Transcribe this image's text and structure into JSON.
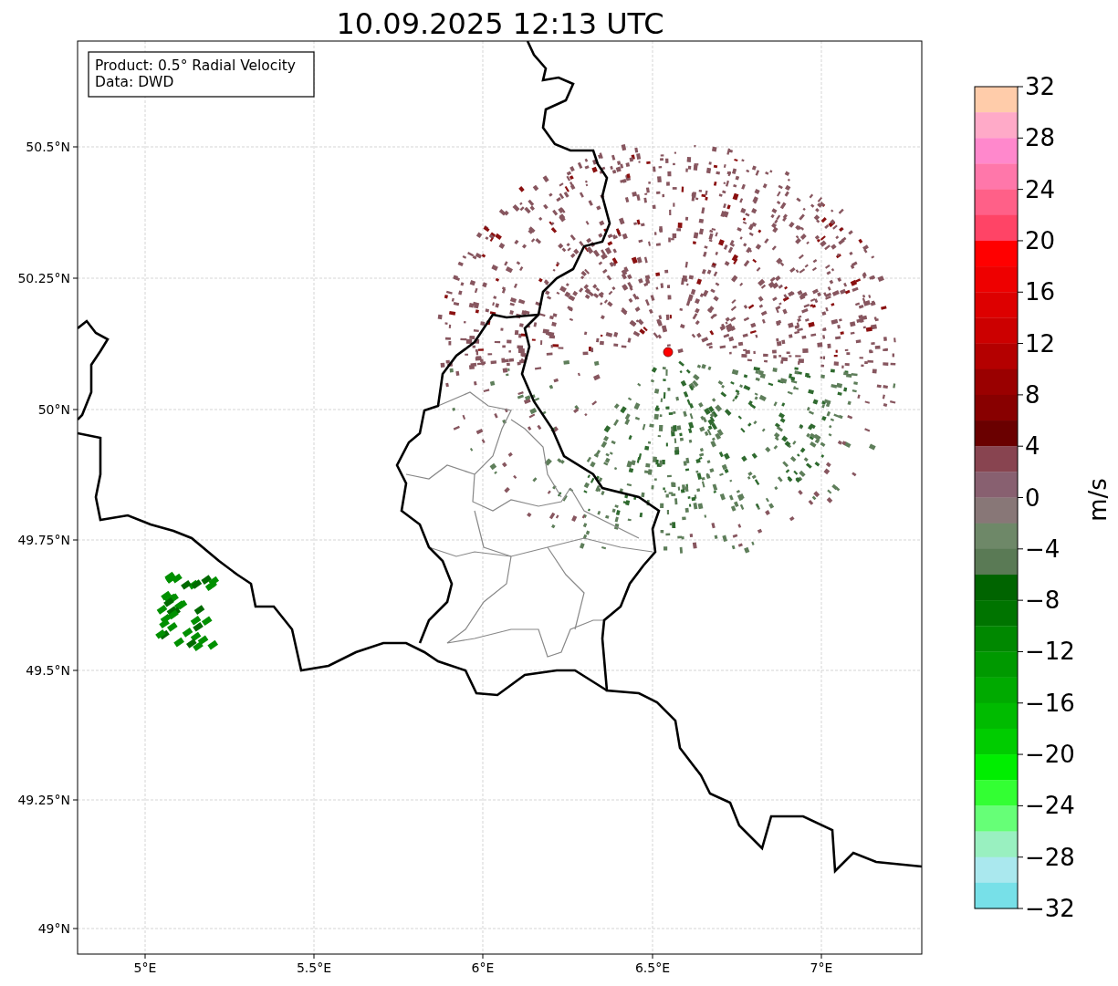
{
  "title": "10.09.2025 12:13 UTC",
  "info_box": {
    "lines": [
      "Product: 0.5° Radial Velocity",
      "Data: DWD"
    ]
  },
  "map": {
    "y_ticks": [
      "50.5°N",
      "50.25°N",
      "50°N",
      "49.75°N",
      "49.5°N",
      "49.25°N",
      "49°N"
    ],
    "x_ticks": [
      "5°E",
      "5.5°E",
      "6°E",
      "6.5°E",
      "7°E"
    ]
  },
  "colorbar": {
    "label": "m/s",
    "ticks": [
      "32",
      "28",
      "24",
      "20",
      "16",
      "12",
      "8",
      "4",
      "0",
      "−4",
      "−8",
      "−12",
      "−16",
      "−20",
      "−24",
      "−28",
      "−32"
    ],
    "segments": [
      {
        "color": "#ffccaa"
      },
      {
        "color": "#ffaac8"
      },
      {
        "color": "#ff88cc"
      },
      {
        "color": "#ff77aa"
      },
      {
        "color": "#ff6088"
      },
      {
        "color": "#ff4466"
      },
      {
        "color": "#ff0000"
      },
      {
        "color": "#ee0000"
      },
      {
        "color": "#dd0000"
      },
      {
        "color": "#cc0000"
      },
      {
        "color": "#b40000"
      },
      {
        "color": "#9a0000"
      },
      {
        "color": "#880000"
      },
      {
        "color": "#6a0000"
      },
      {
        "color": "#884450"
      },
      {
        "color": "#886070"
      },
      {
        "color": "#887777"
      },
      {
        "color": "#6e8868"
      },
      {
        "color": "#5a7a55"
      },
      {
        "color": "#006400"
      },
      {
        "color": "#007400"
      },
      {
        "color": "#008800"
      },
      {
        "color": "#009900"
      },
      {
        "color": "#00aa00"
      },
      {
        "color": "#00bb00"
      },
      {
        "color": "#00cc00"
      },
      {
        "color": "#00ee00"
      },
      {
        "color": "#33ff33"
      },
      {
        "color": "#66ff77"
      },
      {
        "color": "#99f0c0"
      },
      {
        "color": "#aae8ee"
      },
      {
        "color": "#77e0e8"
      }
    ]
  }
}
